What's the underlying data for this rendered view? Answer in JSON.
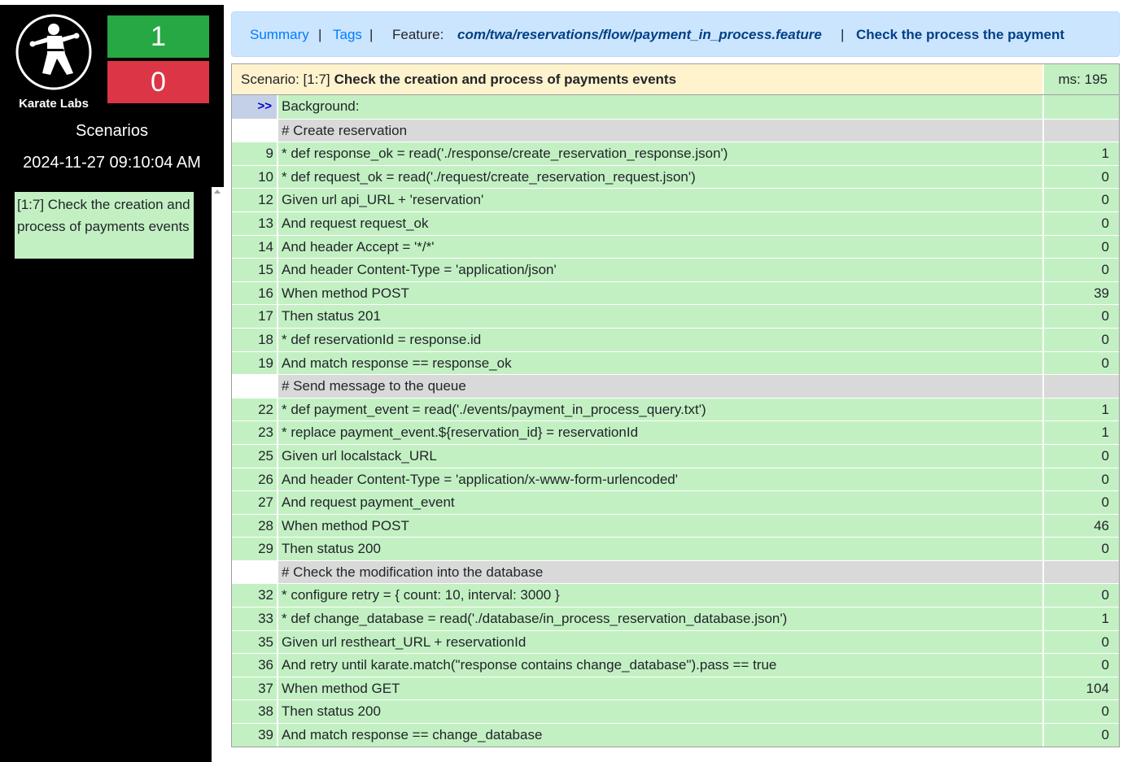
{
  "sidebar": {
    "brand": "Karate Labs",
    "passed_count": "1",
    "failed_count": "0",
    "scenarios_title": "Scenarios",
    "date": "2024-11-27 09:10:04 AM",
    "scenario_item": "[1:7] Check the creation and process of payments events"
  },
  "nav": {
    "summary": "Summary",
    "sep1": "|",
    "tags": "Tags",
    "sep2": "|",
    "feature_label": "Feature:",
    "feature_path": "com/twa/reservations/flow/payment_in_process.feature",
    "sep3": "|",
    "feature_name": "Check the process the payment"
  },
  "scenario": {
    "label": "Scenario: [1:7]",
    "title": "Check the creation and process of payments events",
    "ms": "ms: 195"
  },
  "steps": [
    {
      "num": ">>",
      "text": "Background:",
      "ms": "",
      "kind": "bg"
    },
    {
      "num": "",
      "text": "# Create reservation",
      "ms": "",
      "kind": "comment"
    },
    {
      "num": "9",
      "text": "* def response_ok = read('./response/create_reservation_response.json')",
      "ms": "1",
      "kind": "step"
    },
    {
      "num": "10",
      "text": "* def request_ok = read('./request/create_reservation_request.json')",
      "ms": "0",
      "kind": "step"
    },
    {
      "num": "12",
      "text": "Given url api_URL + 'reservation'",
      "ms": "0",
      "kind": "step"
    },
    {
      "num": "13",
      "text": "And request request_ok",
      "ms": "0",
      "kind": "step"
    },
    {
      "num": "14",
      "text": "And header Accept = '*/*'",
      "ms": "0",
      "kind": "step"
    },
    {
      "num": "15",
      "text": "And header Content-Type = 'application/json'",
      "ms": "0",
      "kind": "step"
    },
    {
      "num": "16",
      "text": "When method POST",
      "ms": "39",
      "kind": "step"
    },
    {
      "num": "17",
      "text": "Then status 201",
      "ms": "0",
      "kind": "step"
    },
    {
      "num": "18",
      "text": "* def reservationId = response.id",
      "ms": "0",
      "kind": "step"
    },
    {
      "num": "19",
      "text": "And match response == response_ok",
      "ms": "0",
      "kind": "step"
    },
    {
      "num": "",
      "text": "# Send message to the queue",
      "ms": "",
      "kind": "comment"
    },
    {
      "num": "22",
      "text": "* def payment_event = read('./events/payment_in_process_query.txt')",
      "ms": "1",
      "kind": "step"
    },
    {
      "num": "23",
      "text": "* replace payment_event.${reservation_id} = reservationId",
      "ms": "1",
      "kind": "step"
    },
    {
      "num": "25",
      "text": "Given url localstack_URL",
      "ms": "0",
      "kind": "step"
    },
    {
      "num": "26",
      "text": "And header Content-Type = 'application/x-www-form-urlencoded'",
      "ms": "0",
      "kind": "step"
    },
    {
      "num": "27",
      "text": "And request payment_event",
      "ms": "0",
      "kind": "step"
    },
    {
      "num": "28",
      "text": "When method POST",
      "ms": "46",
      "kind": "step"
    },
    {
      "num": "29",
      "text": "Then status 200",
      "ms": "0",
      "kind": "step"
    },
    {
      "num": "",
      "text": "# Check the modification into the database",
      "ms": "",
      "kind": "comment"
    },
    {
      "num": "32",
      "text": "* configure retry = { count: 10, interval: 3000 }",
      "ms": "0",
      "kind": "step"
    },
    {
      "num": "33",
      "text": "* def change_database = read('./database/in_process_reservation_database.json')",
      "ms": "1",
      "kind": "step"
    },
    {
      "num": "35",
      "text": "Given url restheart_URL + reservationId",
      "ms": "0",
      "kind": "step"
    },
    {
      "num": "36",
      "text": "And retry until karate.match(\"response contains change_database\").pass == true",
      "ms": "0",
      "kind": "step"
    },
    {
      "num": "37",
      "text": "When method GET",
      "ms": "104",
      "kind": "step"
    },
    {
      "num": "38",
      "text": "Then status 200",
      "ms": "0",
      "kind": "step"
    },
    {
      "num": "39",
      "text": "And match response == change_database",
      "ms": "0",
      "kind": "step"
    }
  ]
}
